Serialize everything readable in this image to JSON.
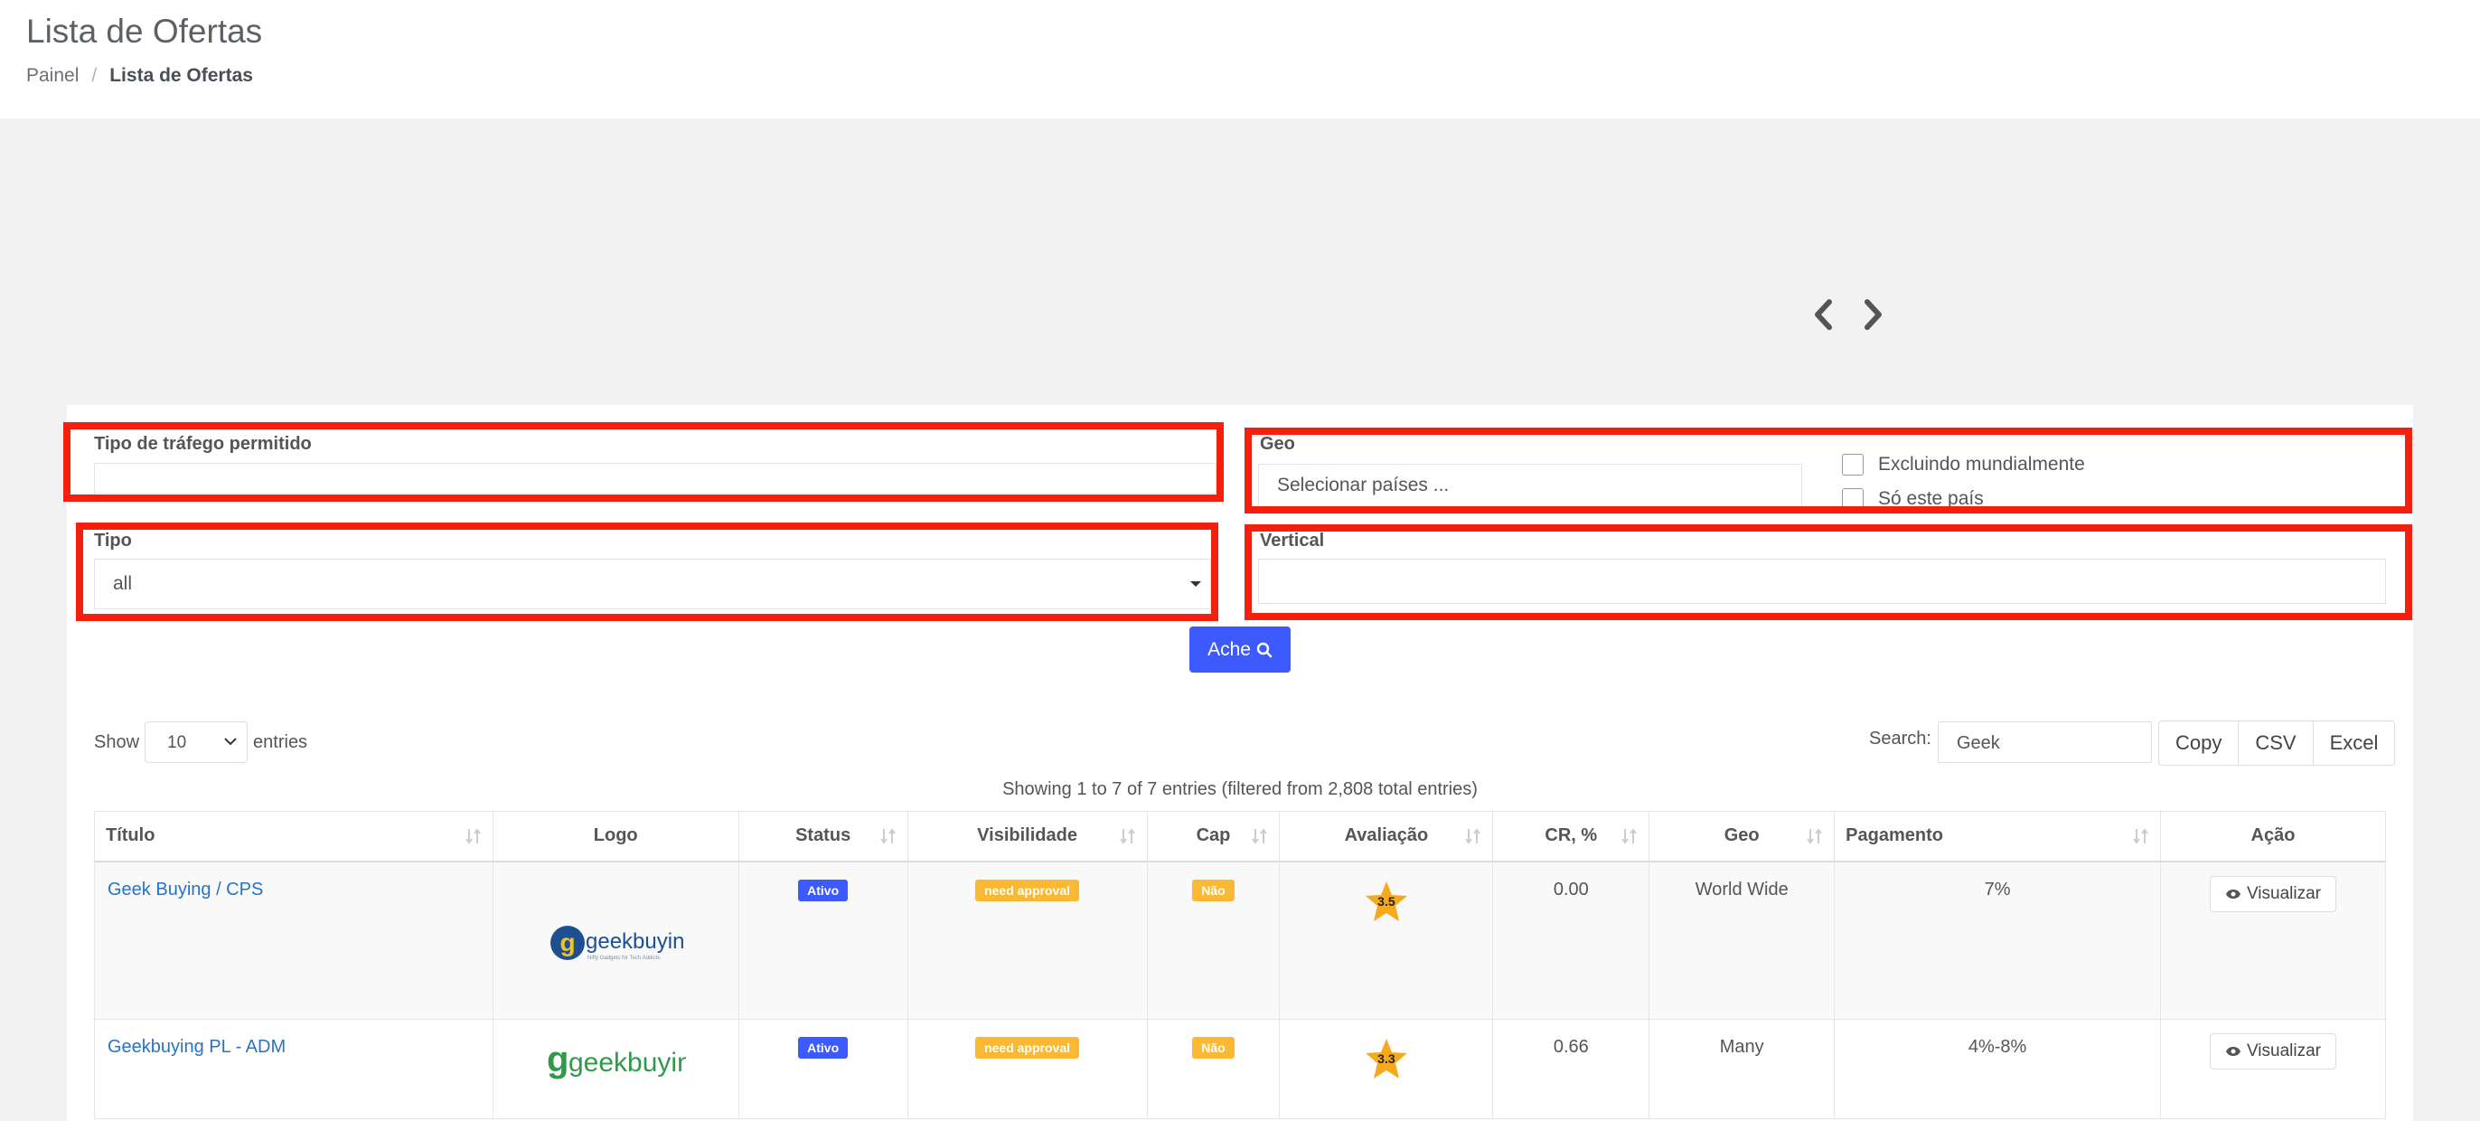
{
  "header": {
    "title": "Lista de Ofertas",
    "breadcrumb": [
      "Painel",
      "/",
      "Lista de Ofertas"
    ]
  },
  "filters": {
    "traffic_label": "Tipo de tráfego permitido",
    "traffic_value": "",
    "geo_label": "Geo",
    "geo_placeholder": "Selecionar países ...",
    "exclude_ww_label": "Excluindo mundialmente",
    "only_country_label": "Só este país",
    "tipo_label": "Tipo",
    "tipo_value": "all",
    "vertical_label": "Vertical",
    "vertical_value": "",
    "search_button": "Ache"
  },
  "table_controls": {
    "show_label": "Show",
    "length_value": "10",
    "entries_label": "entries",
    "search_label": "Search:",
    "search_value": "Geek",
    "buttons": [
      "Copy",
      "CSV",
      "Excel"
    ],
    "info": "Showing 1 to 7 of 7 entries (filtered from 2,808 total entries)"
  },
  "table": {
    "columns": [
      "Título",
      "Logo",
      "Status",
      "Visibilidade",
      "Cap",
      "Avaliação",
      "CR, %",
      "Geo",
      "Pagamento",
      "Ação"
    ],
    "rows": [
      {
        "title": "Geek Buying / CPS",
        "logo": "geekbuying",
        "logo_tagline": "Nifty Gadgets for Tech Addicts",
        "status": "Ativo",
        "visibility": "need approval",
        "cap": "Não",
        "rating": "3.5",
        "cr": "0.00",
        "geo": "World Wide",
        "payout": "7%",
        "action": "Visualizar"
      },
      {
        "title": "Geekbuying PL - ADM",
        "logo": "geekbuying.pl",
        "status": "Ativo",
        "visibility": "need approval",
        "cap": "Não",
        "rating": "3.3",
        "cr": "0.66",
        "geo": "Many",
        "payout": "4%-8%",
        "action": "Visualizar"
      }
    ]
  },
  "colors": {
    "accent": "#3d5afe",
    "highlight": "#f51f0e",
    "badge_orange": "#fbb832",
    "link": "#2773c7",
    "star": "#f6a91b"
  }
}
